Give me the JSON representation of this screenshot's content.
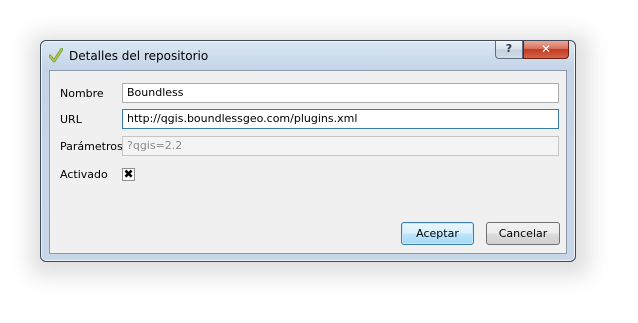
{
  "window": {
    "title": "Detalles del repositorio",
    "help_label": "?",
    "close_label": "✕"
  },
  "form": {
    "name_label": "Nombre",
    "name_value": "Boundless",
    "url_label": "URL",
    "url_value": "http://qgis.boundlessgeo.com/plugins.xml",
    "params_label": "Parámetros",
    "params_value": "?qgis=2.2",
    "enabled_label": "Activado",
    "enabled_mark": "✖"
  },
  "buttons": {
    "accept_label": "Aceptar",
    "cancel_label": "Cancelar"
  },
  "colors": {
    "titlebar": "#c9d9ea",
    "close_button": "#c0391f",
    "default_button_border": "#3c7fb1",
    "focus_border": "#3d7bad"
  },
  "icons": {
    "window_icon": "qgis-checkmark-icon",
    "help": "help-icon",
    "close": "close-icon",
    "checkbox": "check-icon"
  }
}
